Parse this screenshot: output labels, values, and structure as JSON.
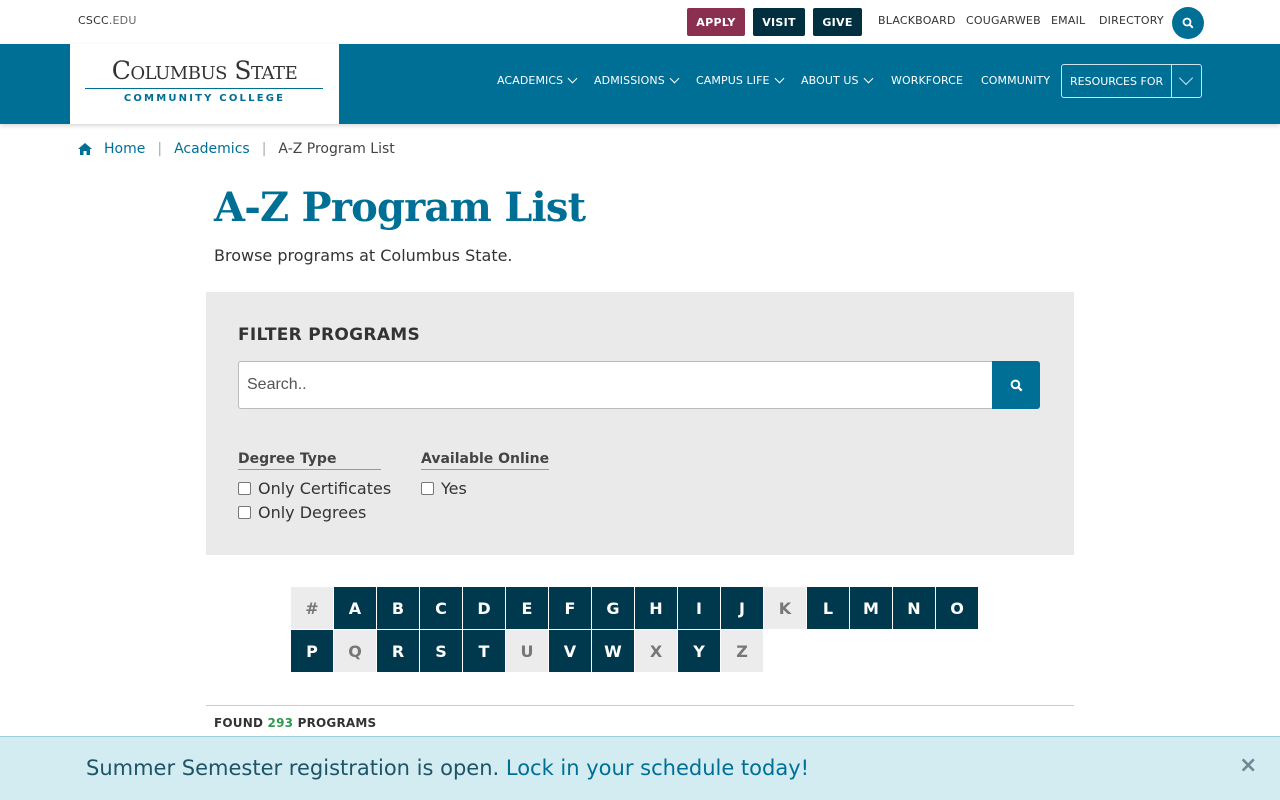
{
  "utility": {
    "domain_main": "CSCC",
    "domain_suffix": ".EDU",
    "apply": "APPLY",
    "visit": "VISIT",
    "give": "GIVE",
    "links": [
      "BLACKBOARD",
      "COUGARWEB",
      "EMAIL",
      "DIRECTORY"
    ]
  },
  "logo": {
    "main": "Columbus State",
    "sub": "COMMUNITY COLLEGE"
  },
  "nav": {
    "items": [
      "ACADEMICS",
      "ADMISSIONS",
      "CAMPUS LIFE",
      "ABOUT US",
      "WORKFORCE",
      "COMMUNITY"
    ],
    "resources": "RESOURCES FOR"
  },
  "breadcrumb": {
    "home": "Home",
    "academics": "Academics",
    "current": "A-Z Program List"
  },
  "page": {
    "title": "A-Z Program List",
    "subtitle": "Browse programs at Columbus State."
  },
  "filter": {
    "title": "FILTER PROGRAMS",
    "search_placeholder": "Search..",
    "degree_type": {
      "heading": "Degree Type",
      "options": [
        "Only Certificates",
        "Only Degrees"
      ]
    },
    "online": {
      "heading": "Available Online",
      "options": [
        "Yes"
      ]
    }
  },
  "letters": [
    {
      "label": "#",
      "active": false
    },
    {
      "label": "A",
      "active": true
    },
    {
      "label": "B",
      "active": true
    },
    {
      "label": "C",
      "active": true
    },
    {
      "label": "D",
      "active": true
    },
    {
      "label": "E",
      "active": true
    },
    {
      "label": "F",
      "active": true
    },
    {
      "label": "G",
      "active": true
    },
    {
      "label": "H",
      "active": true
    },
    {
      "label": "I",
      "active": true
    },
    {
      "label": "J",
      "active": true
    },
    {
      "label": "K",
      "active": false
    },
    {
      "label": "L",
      "active": true
    },
    {
      "label": "M",
      "active": true
    },
    {
      "label": "N",
      "active": true
    },
    {
      "label": "O",
      "active": true
    },
    {
      "label": "P",
      "active": true
    },
    {
      "label": "Q",
      "active": false
    },
    {
      "label": "R",
      "active": true
    },
    {
      "label": "S",
      "active": true
    },
    {
      "label": "T",
      "active": true
    },
    {
      "label": "U",
      "active": false
    },
    {
      "label": "V",
      "active": true
    },
    {
      "label": "W",
      "active": true
    },
    {
      "label": "X",
      "active": false
    },
    {
      "label": "Y",
      "active": true
    },
    {
      "label": "Z",
      "active": false
    }
  ],
  "results": {
    "prefix": "FOUND",
    "count": "293",
    "suffix": "PROGRAMS"
  },
  "banner": {
    "text": "Summer Semester registration is open.",
    "link": "Lock in your schedule today!",
    "close": "×"
  },
  "colors": {
    "brand_blue": "#006f96",
    "dark_navy": "#00384d",
    "apply_maroon": "#8a2f4f",
    "count_green": "#2f9a4f"
  }
}
